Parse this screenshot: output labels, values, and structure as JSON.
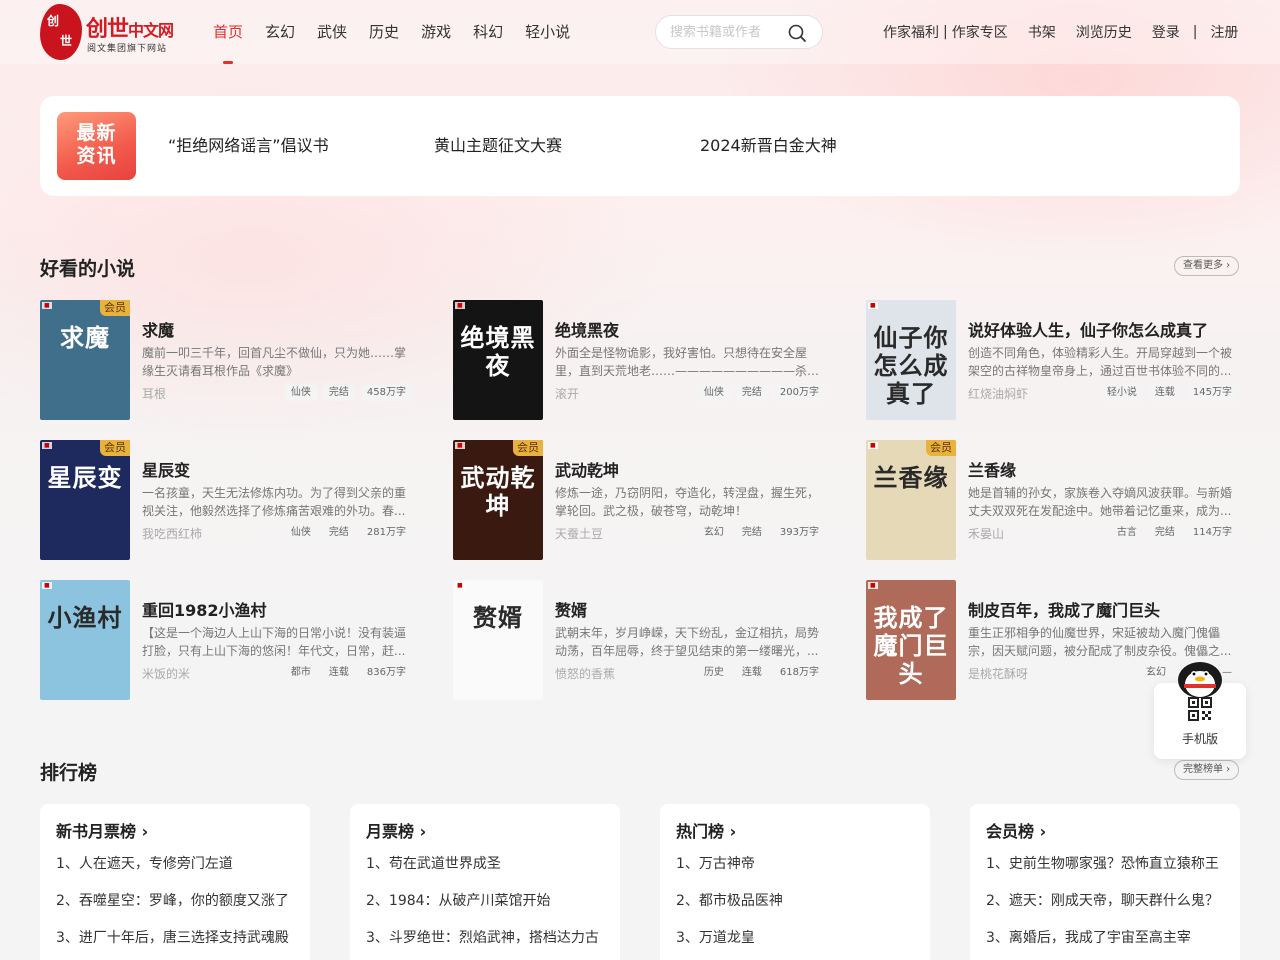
{
  "header": {
    "logo": {
      "seal_chars": [
        "创",
        "世"
      ],
      "main": "创世",
      "main_small": "中文网",
      "sub": "阅文集团旗下网站"
    },
    "nav": [
      {
        "label": "首页",
        "active": true
      },
      {
        "label": "玄幻"
      },
      {
        "label": "武侠"
      },
      {
        "label": "历史"
      },
      {
        "label": "游戏"
      },
      {
        "label": "科幻"
      },
      {
        "label": "轻小说"
      }
    ],
    "search_placeholder": "搜索书籍或作者",
    "links": {
      "author_welfare": "作家福利",
      "divider1": "|",
      "author_zone": "作家专区",
      "bookshelf": "书架",
      "history": "浏览历史",
      "login": "登录",
      "divider2": "|",
      "register": "注册"
    }
  },
  "news": {
    "badge_line1": "最新",
    "badge_line2": "资讯",
    "items": [
      "“拒绝网络谣言”倡议书",
      "黄山主题征文大赛",
      "2024新晋白金大神"
    ]
  },
  "good_novels": {
    "title": "好看的小说",
    "more": "查看更多 ›",
    "books": [
      {
        "title": "求魔",
        "desc": "魔前一叩三千年，回首凡尘不做仙，只为她……掌缘生灭请看耳根作品《求魔》",
        "author": "耳根",
        "tags": [
          "仙侠",
          "完结",
          "458万字"
        ],
        "vip": "会员",
        "cover_text": "求魔",
        "cover_bg": "#3f6f8a"
      },
      {
        "title": "绝境黑夜",
        "desc": "外面全是怪物诡影，我好害怕。只想待在安全屋里，直到天荒地老……——————————杀不死...",
        "author": "滚开",
        "tags": [
          "仙侠",
          "完结",
          "200万字"
        ],
        "vip": "",
        "cover_text": "绝境黑夜",
        "cover_bg": "#141414"
      },
      {
        "title": "说好体验人生，仙子你怎么成真了",
        "desc": "创造不同角色，体验精彩人生。开局穿越到一个被架空的古祥物皇帝身上，通过百世书体验不同的...",
        "author": "红烧油焖虾",
        "tags": [
          "轻小说",
          "连载",
          "145万字"
        ],
        "vip": "",
        "cover_text": "仙子你怎么成真了",
        "cover_bg": "#dfe4ea"
      },
      {
        "title": "星辰变",
        "desc": "一名孩童，天生无法修炼内功。为了得到父亲的重视关注，他毅然选择了修炼痛苦艰难的外功。春...",
        "author": "我吃西红柿",
        "tags": [
          "仙侠",
          "完结",
          "281万字"
        ],
        "vip": "会员",
        "cover_text": "星辰变",
        "cover_bg": "#1e2a5e"
      },
      {
        "title": "武动乾坤",
        "desc": "修炼一途，乃窃阴阳，夺造化，转涅盘，握生死，掌轮回。武之极，破苍穹，动乾坤！",
        "author": "天蚕土豆",
        "tags": [
          "玄幻",
          "完结",
          "393万字"
        ],
        "vip": "会员",
        "cover_text": "武动乾坤",
        "cover_bg": "#3a1a10"
      },
      {
        "title": "兰香缘",
        "desc": "她是首辅的孙女，家族卷入夺嫡风波获罪。与新婚丈夫双双死在发配途中。她带着记忆重来，成为...",
        "author": "禾晏山",
        "tags": [
          "古言",
          "完结",
          "114万字"
        ],
        "vip": "会员",
        "cover_text": "兰香缘",
        "cover_bg": "#e6d9b8"
      },
      {
        "title": "重回1982小渔村",
        "desc": "【这是一个海边人上山下海的日常小说！没有装逼打脸，只有上山下海的悠闲！年代文，日常，赶...",
        "author": "米饭的米",
        "tags": [
          "都市",
          "连载",
          "836万字"
        ],
        "vip": "",
        "cover_text": "小渔村",
        "cover_bg": "#8cc4e0"
      },
      {
        "title": "赘婿",
        "desc": "武朝末年，岁月峥嵘，天下纷乱，金辽相抗，局势动荡，百年屈辱，终于望见结束的第一缕曙光，...",
        "author": "愤怒的香蕉",
        "tags": [
          "历史",
          "连载",
          "618万字"
        ],
        "vip": "",
        "cover_text": "赘婿",
        "cover_bg": "#fafafa"
      },
      {
        "title": "制皮百年，我成了魔门巨头",
        "desc": "重生正邪相争的仙魔世界，宋延被劫入魔门傀儡宗，因天赋问题，被分配成了制皮杂役。傀儡之...",
        "author": "是桃花酥呀",
        "tags": [
          "玄幻",
          "完结",
          "—"
        ],
        "vip": "",
        "cover_text": "我成了魔门巨头",
        "cover_bg": "#b06a5a"
      }
    ]
  },
  "rankings": {
    "title": "排行榜",
    "more": "完整榜单 ›",
    "boards": [
      {
        "title": "新书月票榜 ›",
        "items": [
          "1、人在遮天，专修旁门左道",
          "2、吞噬星空：罗峰，你的额度又涨了",
          "3、进厂十年后，唐三选择支持武魂殿"
        ]
      },
      {
        "title": "月票榜 ›",
        "items": [
          "1、苟在武道世界成圣",
          "2、1984：从破产川菜馆开始",
          "3、斗罗绝世：烈焰武神，搭档达力古"
        ]
      },
      {
        "title": "热门榜 ›",
        "items": [
          "1、万古神帝",
          "2、都市极品医神",
          "3、万道龙皇"
        ]
      },
      {
        "title": "会员榜 ›",
        "items": [
          "1、史前生物哪家强？恐怖直立猿称王",
          "2、遮天：刚成天帝，聊天群什么鬼？",
          "3、离婚后，我成了宇宙至高主宰"
        ]
      }
    ]
  },
  "float": {
    "label": "手机版"
  }
}
